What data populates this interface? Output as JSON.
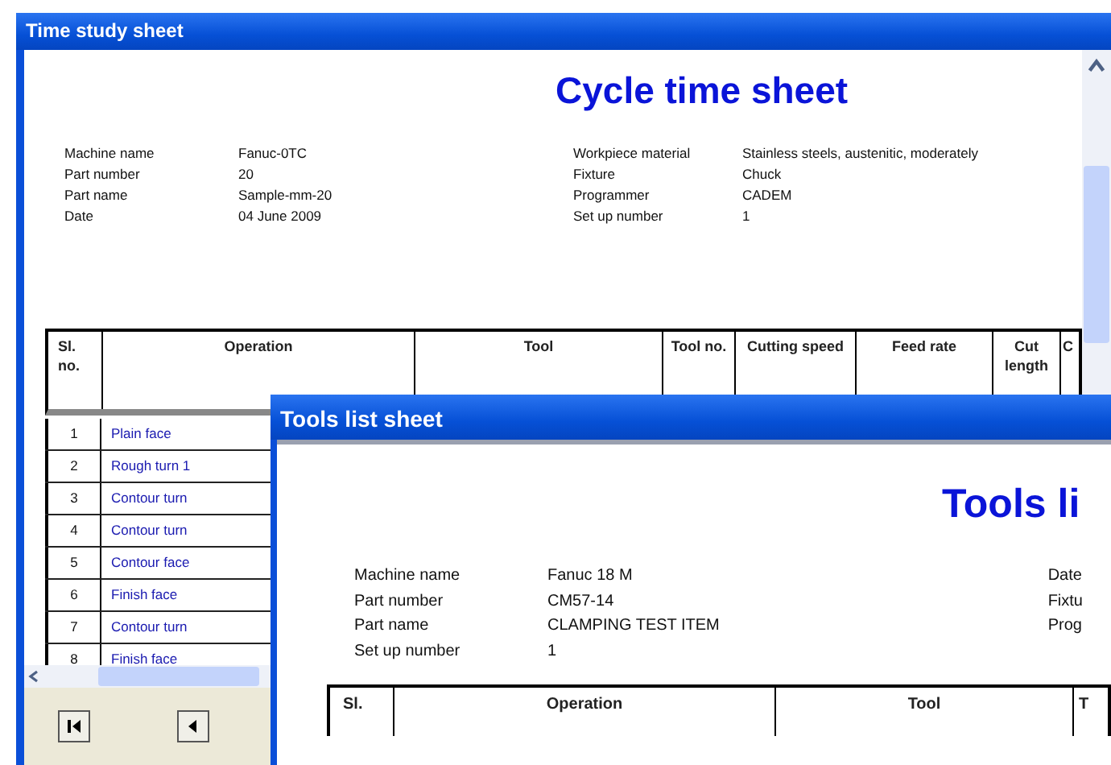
{
  "time_study": {
    "title": "Time study sheet",
    "heading": "Cycle time sheet",
    "info_left": [
      {
        "label": "Machine name",
        "value": "Fanuc-0TC"
      },
      {
        "label": "Part number",
        "value": "20"
      },
      {
        "label": "Part name",
        "value": "Sample-mm-20"
      },
      {
        "label": "Date",
        "value": "04 June 2009"
      }
    ],
    "info_right": [
      {
        "label": "Workpiece material",
        "value": "Stainless steels, austenitic, moderately"
      },
      {
        "label": "Fixture",
        "value": "Chuck"
      },
      {
        "label": "Programmer",
        "value": "CADEM"
      },
      {
        "label": "Set up number",
        "value": "1"
      }
    ],
    "columns": [
      "Sl. no.",
      "Operation",
      "Tool",
      "Tool no.",
      "Cutting speed",
      "Feed rate",
      "Cut length",
      "C"
    ],
    "rows": [
      {
        "no": "1",
        "operation": "Plain face"
      },
      {
        "no": "2",
        "operation": "Rough turn 1"
      },
      {
        "no": "3",
        "operation": "Contour turn"
      },
      {
        "no": "4",
        "operation": "Contour turn"
      },
      {
        "no": "5",
        "operation": "Contour face"
      },
      {
        "no": "6",
        "operation": "Finish face"
      },
      {
        "no": "7",
        "operation": "Contour turn"
      },
      {
        "no": "8",
        "operation": "Finish face"
      }
    ]
  },
  "tools_list": {
    "title": "Tools list sheet",
    "heading": "Tools li",
    "info_left": [
      {
        "label": "Machine name",
        "value": "Fanuc 18 M"
      },
      {
        "label": "Part number",
        "value": "CM57-14"
      },
      {
        "label": "Part name",
        "value": "CLAMPING TEST ITEM"
      },
      {
        "label": "Set up number",
        "value": "1"
      }
    ],
    "info_right": [
      "Date",
      "Fixtu",
      "Prog"
    ],
    "columns": [
      "Sl.",
      "Operation",
      "Tool",
      "T"
    ]
  }
}
